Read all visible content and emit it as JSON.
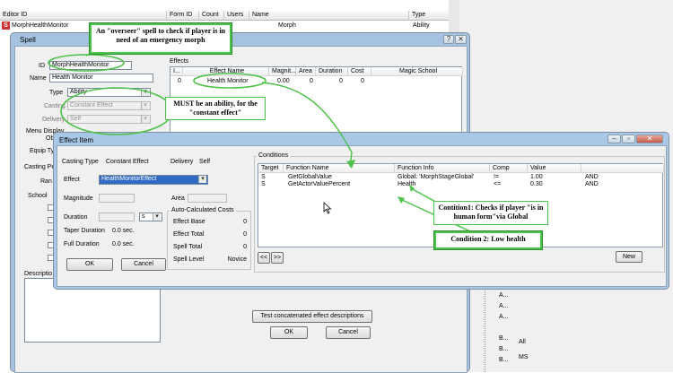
{
  "main_list": {
    "columns": [
      "Editor ID",
      "Form ID",
      "Count",
      "Users",
      "Name",
      "Type"
    ],
    "row": {
      "editor_id": "MorphHealthMonitor",
      "name": "Morph",
      "type": "Ability"
    }
  },
  "spell": {
    "title": "Spell",
    "id_label": "ID",
    "id_value": "MorphHealthMonitor",
    "name_label": "Name",
    "name_value": "Health Monitor",
    "type_label": "Type",
    "type_value": "Ability",
    "casting_label": "Casting",
    "casting_value": "Constant Effect",
    "delivery_label": "Delivery",
    "delivery_value": "Self",
    "menu_display_label": "Menu Display",
    "menu_display_label2": "Obj",
    "equip_type_label": "Equip Ty",
    "casting_perk_label": "Casting Pe",
    "range_label": "Ran",
    "school_label": "School",
    "description_label": "Descriptio",
    "effects_label": "Effects",
    "effects_columns": [
      "I...",
      "Effect Name",
      "Magnit...",
      "Area",
      "Duration",
      "Cost",
      "Magic School"
    ],
    "effects_row": {
      "i": "0",
      "name": "Health Monitor",
      "magnitude": "0.00",
      "area": "0",
      "duration": "0",
      "cost": "0"
    },
    "test_button": "Test concatenated effect descriptions",
    "ok_button": "OK",
    "cancel_button": "Cancel"
  },
  "effect_item": {
    "title": "Effect Item",
    "casting_type_label": "Casting Type",
    "casting_type_value": "Constant Effect",
    "delivery_label": "Delivery",
    "delivery_value": "Self",
    "effect_label": "Effect",
    "effect_value": "HealthMonitorEffect",
    "magnitude_label": "Magnitude",
    "area_label": "Area",
    "duration_label": "Duration",
    "duration_unit": "s",
    "taper_duration_label": "Taper Duration",
    "taper_duration_value": "0.0 sec.",
    "full_duration_label": "Full Duration",
    "full_duration_value": "0.0 sec.",
    "ok_button": "OK",
    "cancel_button": "Cancel",
    "auto_costs": {
      "title": "Auto-Calculated Costs",
      "rows": [
        {
          "label": "Effect Base",
          "value": "0"
        },
        {
          "label": "Effect Total",
          "value": "0"
        },
        {
          "label": "Spell Total",
          "value": "0"
        },
        {
          "label": "Spell Level",
          "value": "Novice"
        }
      ]
    },
    "conditions": {
      "title": "Conditions",
      "columns": [
        "Target",
        "Function Name",
        "Function Info",
        "Comp",
        "Value"
      ],
      "rows": [
        {
          "target": "S",
          "function": "GetGlobalValue",
          "info": "Global: 'MorphStageGlobal'",
          "comp": "!=",
          "value": "1.00",
          "op": "AND"
        },
        {
          "target": "S",
          "function": "GetActorValuePercent",
          "info": "Health",
          "comp": "<=",
          "value": "0.30",
          "op": "AND"
        }
      ],
      "prev_button": "<<",
      "next_button": ">>",
      "new_button": "New"
    }
  },
  "annotations": {
    "overseer": "An \"overseer\" spell to check if player is in need of an emergency morph",
    "must_be": "MUST be an ability, for the \"constant effect\"",
    "condition1": "Contition1: Checks if player \"is in human form\"via Global",
    "condition2": "Condition 2: Low health"
  },
  "right_list": {
    "rows": [
      "A...",
      "A...",
      "A...",
      "B...",
      "B...",
      "B..."
    ],
    "side_a": "All",
    "side_b": "MS"
  },
  "colors": {
    "callout_border": "#4ec24a",
    "title_bar": "#a5c3e0"
  }
}
